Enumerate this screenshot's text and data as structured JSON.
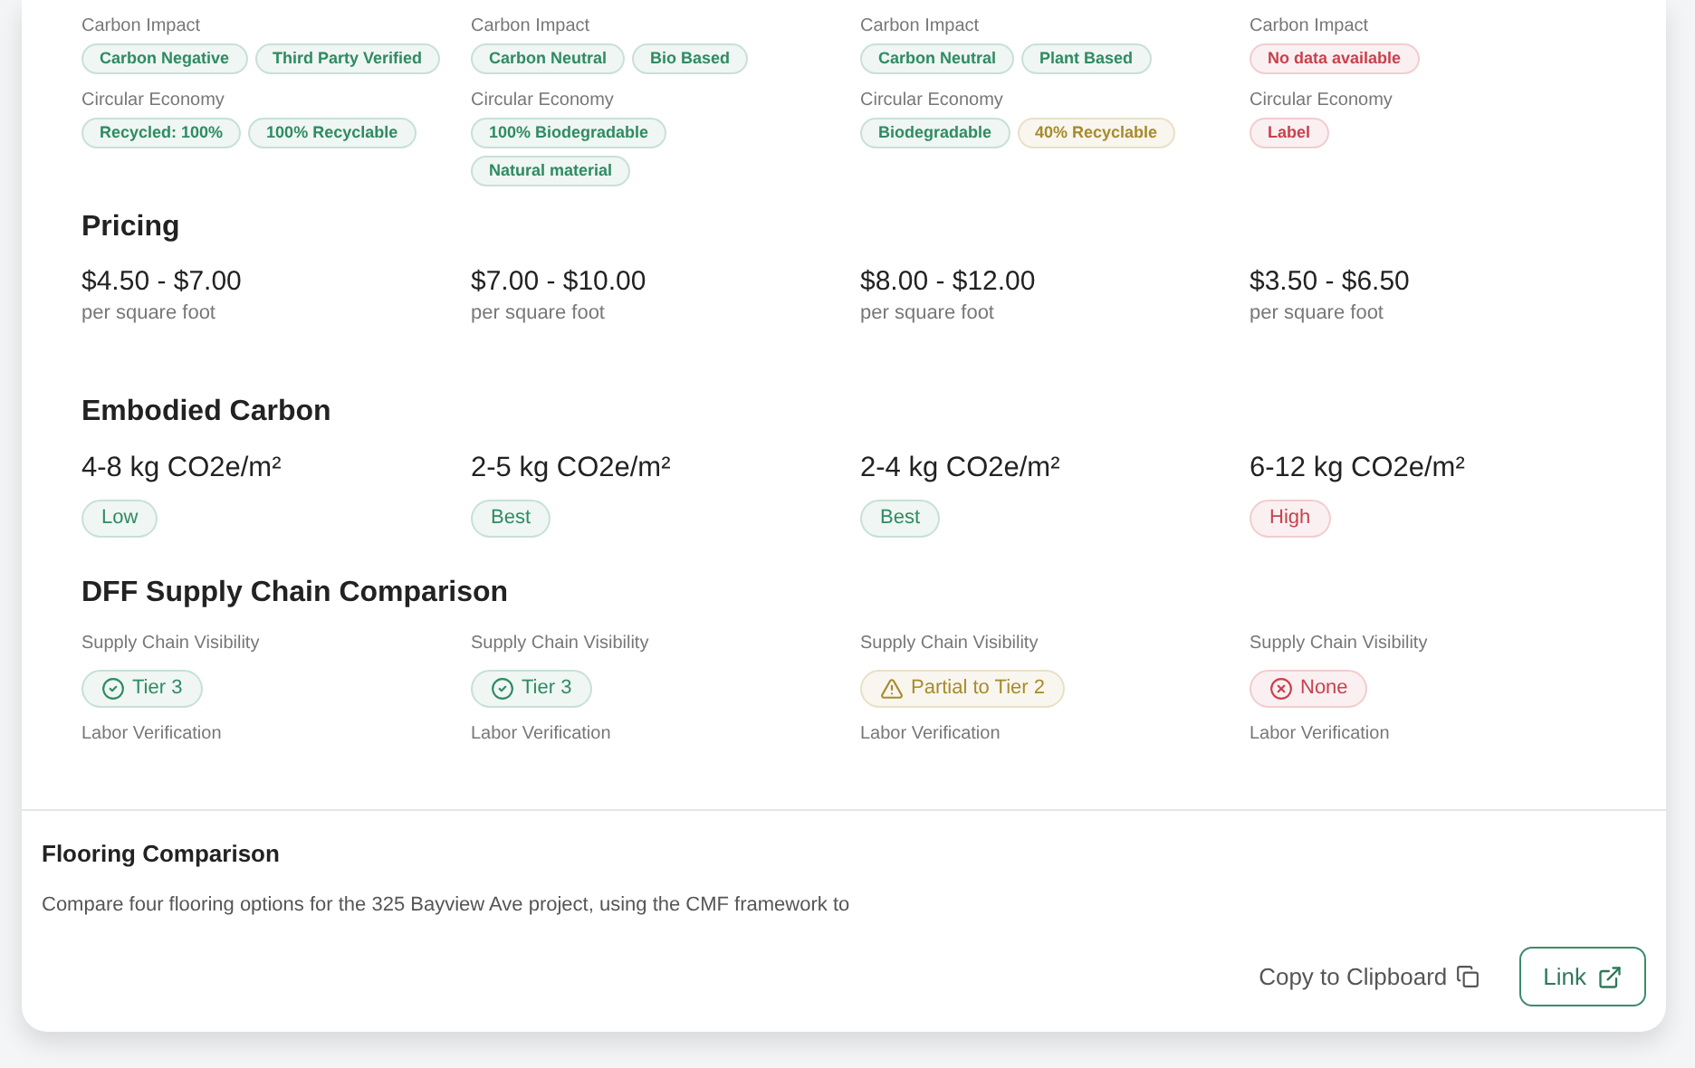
{
  "attributes": [
    {
      "groups": [
        {
          "label": "Carbon Impact",
          "tags": [
            {
              "text": "Carbon Negative",
              "color": "#2e8b62"
            },
            {
              "text": "Third Party Verified",
              "color": "#2e8b62"
            }
          ]
        },
        {
          "label": "Circular Economy",
          "tags": [
            {
              "text": "Recycled: 100%",
              "color": "#2e8b62"
            },
            {
              "text": "100% Recyclable",
              "color": "#2e8b62"
            }
          ]
        }
      ]
    },
    {
      "groups": [
        {
          "label": "Carbon Impact",
          "tags": [
            {
              "text": "Carbon Neutral",
              "color": "#2e8b62"
            },
            {
              "text": "Bio Based",
              "color": "#2e8b62"
            }
          ]
        },
        {
          "label": "Circular Economy",
          "tags": [
            {
              "text": "100% Biodegradable",
              "color": "#2e8b62"
            },
            {
              "text": "Natural material",
              "color": "#2e8b62"
            }
          ]
        }
      ]
    },
    {
      "groups": [
        {
          "label": "Carbon Impact",
          "tags": [
            {
              "text": "Carbon Neutral",
              "color": "#2e8b62"
            },
            {
              "text": "Plant Based",
              "color": "#2e8b62"
            }
          ]
        },
        {
          "label": "Circular Economy",
          "tags": [
            {
              "text": "Biodegradable",
              "color": "#2e8b62"
            },
            {
              "text": "40% Recyclable",
              "color": "#a88a2c"
            }
          ]
        }
      ]
    },
    {
      "groups": [
        {
          "label": "Carbon Impact",
          "tags": [
            {
              "text": "No data available",
              "color": "#c8414c"
            }
          ]
        },
        {
          "label": "Circular Economy",
          "tags": [
            {
              "text": "Label",
              "color": "#c8414c"
            }
          ]
        }
      ]
    }
  ],
  "pricing": {
    "title": "Pricing",
    "items": [
      {
        "price": "$4.50 - $7.00",
        "unit": "per square foot"
      },
      {
        "price": "$7.00 - $10.00",
        "unit": "per square foot"
      },
      {
        "price": "$8.00 - $12.00",
        "unit": "per square foot"
      },
      {
        "price": "$3.50 - $6.50",
        "unit": "per square foot"
      }
    ]
  },
  "embodied_carbon": {
    "title": "Embodied Carbon",
    "items": [
      {
        "value": "4-8 kg CO2e/m²",
        "rating": "Low",
        "color": "#2e8b62"
      },
      {
        "value": "2-5 kg CO2e/m²",
        "rating": "Best",
        "color": "#2e8b62"
      },
      {
        "value": "2-4 kg CO2e/m²",
        "rating": "Best",
        "color": "#2e8b62"
      },
      {
        "value": "6-12 kg CO2e/m²",
        "rating": "High",
        "color": "#c8414c"
      }
    ]
  },
  "supply_chain": {
    "title": "DFF Supply Chain Comparison",
    "items": [
      {
        "visibility_label": "Supply Chain Visibility",
        "kind": "ok",
        "visibility": "Tier 3",
        "color": "#2e8b62",
        "labor_label": "Labor Verification"
      },
      {
        "visibility_label": "Supply Chain Visibility",
        "kind": "ok",
        "visibility": "Tier 3",
        "color": "#2e8b62",
        "labor_label": "Labor Verification"
      },
      {
        "visibility_label": "Supply Chain Visibility",
        "kind": "partial",
        "visibility": "Partial to Tier 2",
        "color": "#a88a2c",
        "labor_label": "Labor Verification"
      },
      {
        "visibility_label": "Supply Chain Visibility",
        "kind": "none",
        "visibility": "None",
        "color": "#c8414c",
        "labor_label": "Labor Verification"
      }
    ]
  },
  "footer": {
    "title": "Flooring Comparison",
    "description": "Compare four flooring options for the 325 Bayview Ave project, using the CMF framework to",
    "copy_label": "Copy to Clipboard",
    "link_label": "Link"
  }
}
